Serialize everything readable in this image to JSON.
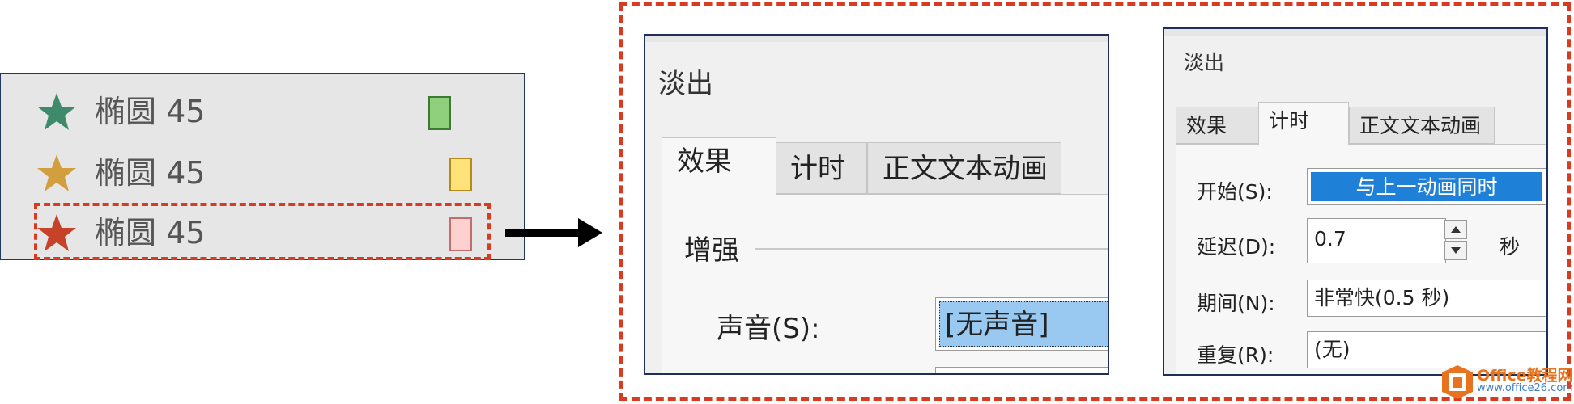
{
  "animation_pane": {
    "items": [
      {
        "icon": "star-icon",
        "label": "椭圆 45",
        "star_color": "#3e8a6a",
        "bar_fill": "#8fd07d",
        "bar_border": "#3e7a35"
      },
      {
        "icon": "star-icon",
        "label": "椭圆 45",
        "star_color": "#d39f3e",
        "bar_fill": "#ffe27a",
        "bar_border": "#b58a16"
      },
      {
        "icon": "star-icon",
        "label": "椭圆 45",
        "star_color": "#c6432a",
        "bar_fill": "#ffd0d0",
        "bar_border": "#c46d6d"
      }
    ],
    "highlight_color": "#d83b21"
  },
  "dialog_effect": {
    "title": "淡出",
    "tabs": [
      "效果",
      "计时",
      "正文文本动画"
    ],
    "active_tab": "效果",
    "group_label": "增强",
    "sound_label": "声音(S):",
    "sound_value": "[无声音]"
  },
  "dialog_timing": {
    "title": "淡出",
    "tabs": [
      "效果",
      "计时",
      "正文文本动画"
    ],
    "active_tab": "计时",
    "start_label": "开始(S):",
    "start_value": "与上一动画同时",
    "delay_label": "延迟(D):",
    "delay_value": "0.7",
    "delay_unit": "秒",
    "duration_label": "期间(N):",
    "duration_value": "非常快(0.5 秒)",
    "repeat_label": "重复(R):",
    "repeat_value": "(无)"
  },
  "watermark": {
    "name": "Office教程网",
    "url": "www.office26.com"
  },
  "colors": {
    "frame": "#d83b21",
    "dialog_border": "#1f2f5c",
    "selection": "#1f80d8",
    "sound_selection": "#99c9f0"
  }
}
